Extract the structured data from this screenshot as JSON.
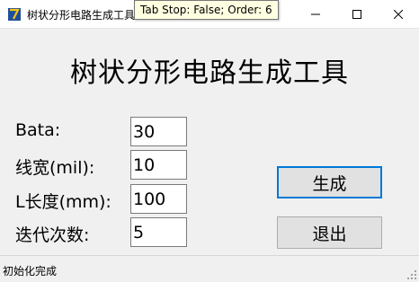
{
  "window": {
    "title": "树状分形电路生成工具",
    "icon": "app-logo-icon",
    "controls": [
      "minimize-icon",
      "maximize-icon",
      "close-icon"
    ]
  },
  "tooltip": {
    "text": "Tab Stop: False; Order: 6"
  },
  "main": {
    "heading": "树状分形电路生成工具",
    "fields": [
      {
        "label": "Bata:",
        "value": "30"
      },
      {
        "label": "线宽(mil):",
        "value": "10"
      },
      {
        "label": "L长度(mm):",
        "value": "100"
      },
      {
        "label": "迭代次数:",
        "value": "5"
      }
    ],
    "buttons": {
      "generate": "生成",
      "exit": "退出"
    }
  },
  "status": {
    "text": "初始化完成"
  },
  "colors": {
    "accent": "#0078d7",
    "background": "#f0f0f0"
  }
}
